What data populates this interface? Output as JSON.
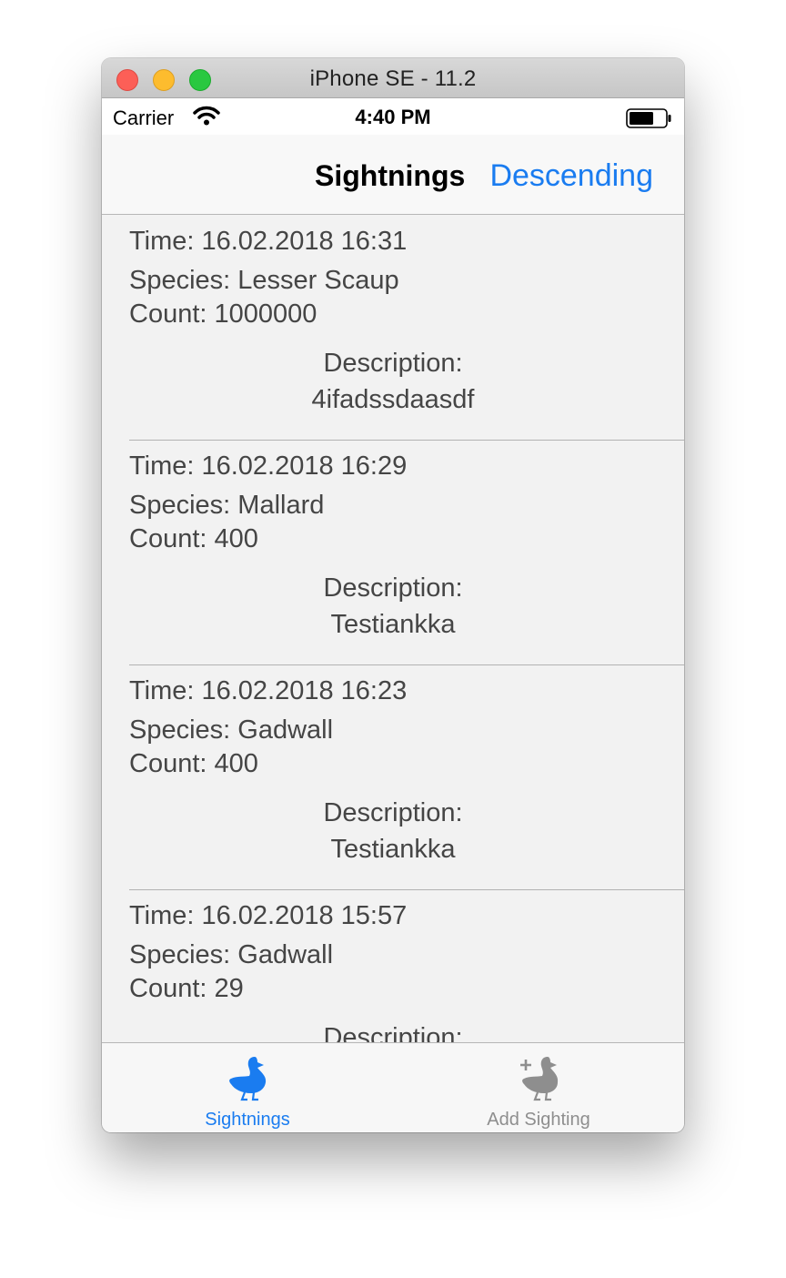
{
  "window": {
    "title": "iPhone SE - 11.2"
  },
  "status_bar": {
    "carrier": "Carrier",
    "time": "4:40 PM"
  },
  "nav": {
    "title": "Sightnings",
    "sort_button": "Descending"
  },
  "sightings": [
    {
      "time": "Time: 16.02.2018 16:31",
      "species": "Species: Lesser Scaup",
      "count": "Count: 1000000",
      "description_label": "Description:",
      "description": "4ifadssdaasdf"
    },
    {
      "time": "Time: 16.02.2018 16:29",
      "species": "Species: Mallard",
      "count": "Count: 400",
      "description_label": "Description:",
      "description": "Testiankka"
    },
    {
      "time": "Time: 16.02.2018 16:23",
      "species": "Species: Gadwall",
      "count": "Count: 400",
      "description_label": "Description:",
      "description": "Testiankka"
    },
    {
      "time": "Time: 16.02.2018 15:57",
      "species": "Species: Gadwall",
      "count": "Count: 29",
      "description_label": "Description:",
      "description": ""
    }
  ],
  "tabs": [
    {
      "label": "Sightnings",
      "icon": "duck-icon",
      "active": true,
      "color": "#1a7cf0"
    },
    {
      "label": "Add Sighting",
      "icon": "add-duck-icon",
      "active": false,
      "color": "#8e8e8e"
    }
  ]
}
